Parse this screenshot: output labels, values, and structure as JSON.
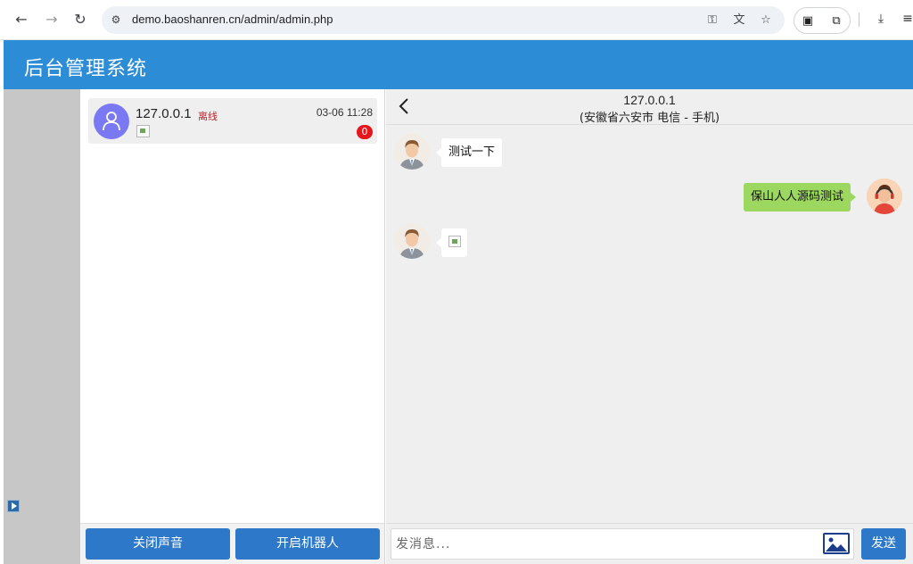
{
  "browser": {
    "url": "demo.baoshanren.cn/admin/admin.php",
    "back_icon": "arrow-left-icon",
    "forward_icon": "arrow-right-icon",
    "reload_icon": "reload-icon",
    "back_glyph": "←",
    "forward_glyph": "→",
    "reload_glyph": "↻",
    "site_glyph": "⚙",
    "key_glyph": "⚿",
    "translate_glyph": "文",
    "star_glyph": "☆",
    "ext1_glyph": "▣",
    "ext2_glyph": "⧉",
    "download_glyph": "⤓",
    "menu_glyph": "≡"
  },
  "header": {
    "title": "后台管理系统",
    "color": "#2d8cd6"
  },
  "sessions": [
    {
      "ip": "127.0.0.1",
      "status": "离线",
      "time": "03-06 11:28",
      "unread": "0"
    }
  ],
  "session_footer": {
    "mute_label": "关闭声音",
    "robot_label": "开启机器人"
  },
  "chat": {
    "title": "127.0.0.1",
    "subtitle": "(安徽省六安市 电信 - 手机)",
    "messages": [
      {
        "direction": "in",
        "text": "测试一下"
      },
      {
        "direction": "out",
        "text": "保山人人源码测试"
      },
      {
        "direction": "in",
        "text": ""
      }
    ],
    "input_placeholder": "发消息...",
    "send_label": "发送"
  }
}
